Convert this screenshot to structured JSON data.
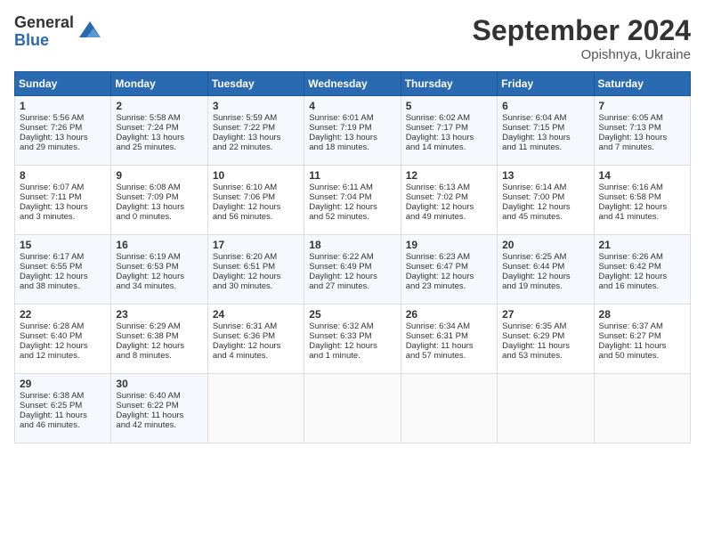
{
  "header": {
    "logo_general": "General",
    "logo_blue": "Blue",
    "month_title": "September 2024",
    "subtitle": "Opishnya, Ukraine"
  },
  "days_of_week": [
    "Sunday",
    "Monday",
    "Tuesday",
    "Wednesday",
    "Thursday",
    "Friday",
    "Saturday"
  ],
  "weeks": [
    [
      {
        "day": "1",
        "lines": [
          "Sunrise: 5:56 AM",
          "Sunset: 7:26 PM",
          "Daylight: 13 hours",
          "and 29 minutes."
        ]
      },
      {
        "day": "2",
        "lines": [
          "Sunrise: 5:58 AM",
          "Sunset: 7:24 PM",
          "Daylight: 13 hours",
          "and 25 minutes."
        ]
      },
      {
        "day": "3",
        "lines": [
          "Sunrise: 5:59 AM",
          "Sunset: 7:22 PM",
          "Daylight: 13 hours",
          "and 22 minutes."
        ]
      },
      {
        "day": "4",
        "lines": [
          "Sunrise: 6:01 AM",
          "Sunset: 7:19 PM",
          "Daylight: 13 hours",
          "and 18 minutes."
        ]
      },
      {
        "day": "5",
        "lines": [
          "Sunrise: 6:02 AM",
          "Sunset: 7:17 PM",
          "Daylight: 13 hours",
          "and 14 minutes."
        ]
      },
      {
        "day": "6",
        "lines": [
          "Sunrise: 6:04 AM",
          "Sunset: 7:15 PM",
          "Daylight: 13 hours",
          "and 11 minutes."
        ]
      },
      {
        "day": "7",
        "lines": [
          "Sunrise: 6:05 AM",
          "Sunset: 7:13 PM",
          "Daylight: 13 hours",
          "and 7 minutes."
        ]
      }
    ],
    [
      {
        "day": "8",
        "lines": [
          "Sunrise: 6:07 AM",
          "Sunset: 7:11 PM",
          "Daylight: 13 hours",
          "and 3 minutes."
        ]
      },
      {
        "day": "9",
        "lines": [
          "Sunrise: 6:08 AM",
          "Sunset: 7:09 PM",
          "Daylight: 13 hours",
          "and 0 minutes."
        ]
      },
      {
        "day": "10",
        "lines": [
          "Sunrise: 6:10 AM",
          "Sunset: 7:06 PM",
          "Daylight: 12 hours",
          "and 56 minutes."
        ]
      },
      {
        "day": "11",
        "lines": [
          "Sunrise: 6:11 AM",
          "Sunset: 7:04 PM",
          "Daylight: 12 hours",
          "and 52 minutes."
        ]
      },
      {
        "day": "12",
        "lines": [
          "Sunrise: 6:13 AM",
          "Sunset: 7:02 PM",
          "Daylight: 12 hours",
          "and 49 minutes."
        ]
      },
      {
        "day": "13",
        "lines": [
          "Sunrise: 6:14 AM",
          "Sunset: 7:00 PM",
          "Daylight: 12 hours",
          "and 45 minutes."
        ]
      },
      {
        "day": "14",
        "lines": [
          "Sunrise: 6:16 AM",
          "Sunset: 6:58 PM",
          "Daylight: 12 hours",
          "and 41 minutes."
        ]
      }
    ],
    [
      {
        "day": "15",
        "lines": [
          "Sunrise: 6:17 AM",
          "Sunset: 6:55 PM",
          "Daylight: 12 hours",
          "and 38 minutes."
        ]
      },
      {
        "day": "16",
        "lines": [
          "Sunrise: 6:19 AM",
          "Sunset: 6:53 PM",
          "Daylight: 12 hours",
          "and 34 minutes."
        ]
      },
      {
        "day": "17",
        "lines": [
          "Sunrise: 6:20 AM",
          "Sunset: 6:51 PM",
          "Daylight: 12 hours",
          "and 30 minutes."
        ]
      },
      {
        "day": "18",
        "lines": [
          "Sunrise: 6:22 AM",
          "Sunset: 6:49 PM",
          "Daylight: 12 hours",
          "and 27 minutes."
        ]
      },
      {
        "day": "19",
        "lines": [
          "Sunrise: 6:23 AM",
          "Sunset: 6:47 PM",
          "Daylight: 12 hours",
          "and 23 minutes."
        ]
      },
      {
        "day": "20",
        "lines": [
          "Sunrise: 6:25 AM",
          "Sunset: 6:44 PM",
          "Daylight: 12 hours",
          "and 19 minutes."
        ]
      },
      {
        "day": "21",
        "lines": [
          "Sunrise: 6:26 AM",
          "Sunset: 6:42 PM",
          "Daylight: 12 hours",
          "and 16 minutes."
        ]
      }
    ],
    [
      {
        "day": "22",
        "lines": [
          "Sunrise: 6:28 AM",
          "Sunset: 6:40 PM",
          "Daylight: 12 hours",
          "and 12 minutes."
        ]
      },
      {
        "day": "23",
        "lines": [
          "Sunrise: 6:29 AM",
          "Sunset: 6:38 PM",
          "Daylight: 12 hours",
          "and 8 minutes."
        ]
      },
      {
        "day": "24",
        "lines": [
          "Sunrise: 6:31 AM",
          "Sunset: 6:36 PM",
          "Daylight: 12 hours",
          "and 4 minutes."
        ]
      },
      {
        "day": "25",
        "lines": [
          "Sunrise: 6:32 AM",
          "Sunset: 6:33 PM",
          "Daylight: 12 hours",
          "and 1 minute."
        ]
      },
      {
        "day": "26",
        "lines": [
          "Sunrise: 6:34 AM",
          "Sunset: 6:31 PM",
          "Daylight: 11 hours",
          "and 57 minutes."
        ]
      },
      {
        "day": "27",
        "lines": [
          "Sunrise: 6:35 AM",
          "Sunset: 6:29 PM",
          "Daylight: 11 hours",
          "and 53 minutes."
        ]
      },
      {
        "day": "28",
        "lines": [
          "Sunrise: 6:37 AM",
          "Sunset: 6:27 PM",
          "Daylight: 11 hours",
          "and 50 minutes."
        ]
      }
    ],
    [
      {
        "day": "29",
        "lines": [
          "Sunrise: 6:38 AM",
          "Sunset: 6:25 PM",
          "Daylight: 11 hours",
          "and 46 minutes."
        ]
      },
      {
        "day": "30",
        "lines": [
          "Sunrise: 6:40 AM",
          "Sunset: 6:22 PM",
          "Daylight: 11 hours",
          "and 42 minutes."
        ]
      },
      {
        "day": "",
        "lines": []
      },
      {
        "day": "",
        "lines": []
      },
      {
        "day": "",
        "lines": []
      },
      {
        "day": "",
        "lines": []
      },
      {
        "day": "",
        "lines": []
      }
    ]
  ]
}
